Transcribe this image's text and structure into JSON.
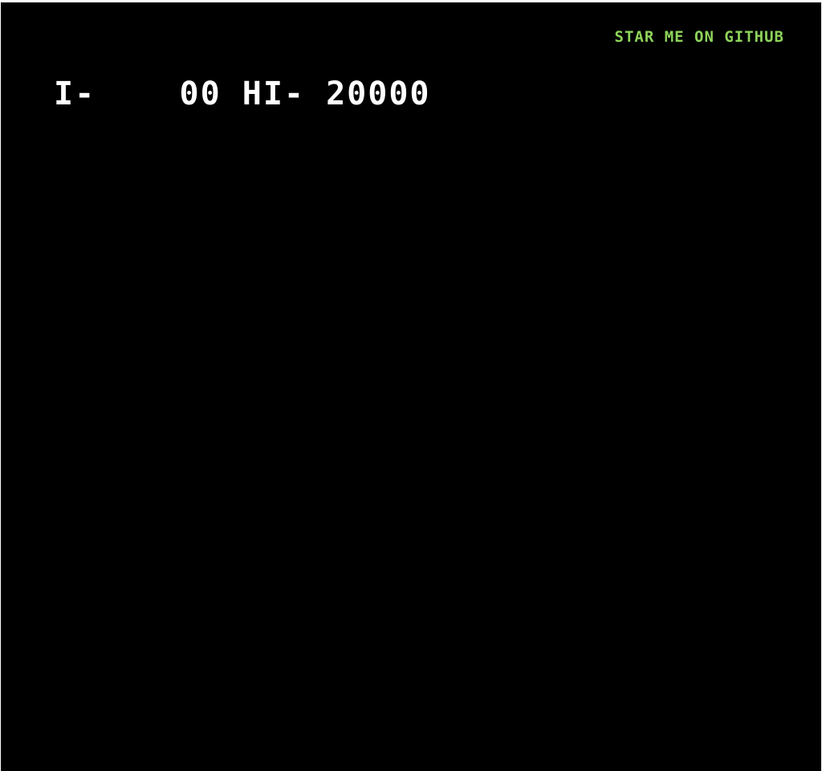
{
  "github_link": {
    "label": "STAR ME ON GITHUB",
    "color": "#8ed35a"
  },
  "score_bar": {
    "player_label": "I-",
    "player_score": "    00",
    "hi_label": " HI-",
    "hi_score": " 20000",
    "color": "#ffffff"
  },
  "colors": {
    "background": "#000000"
  }
}
